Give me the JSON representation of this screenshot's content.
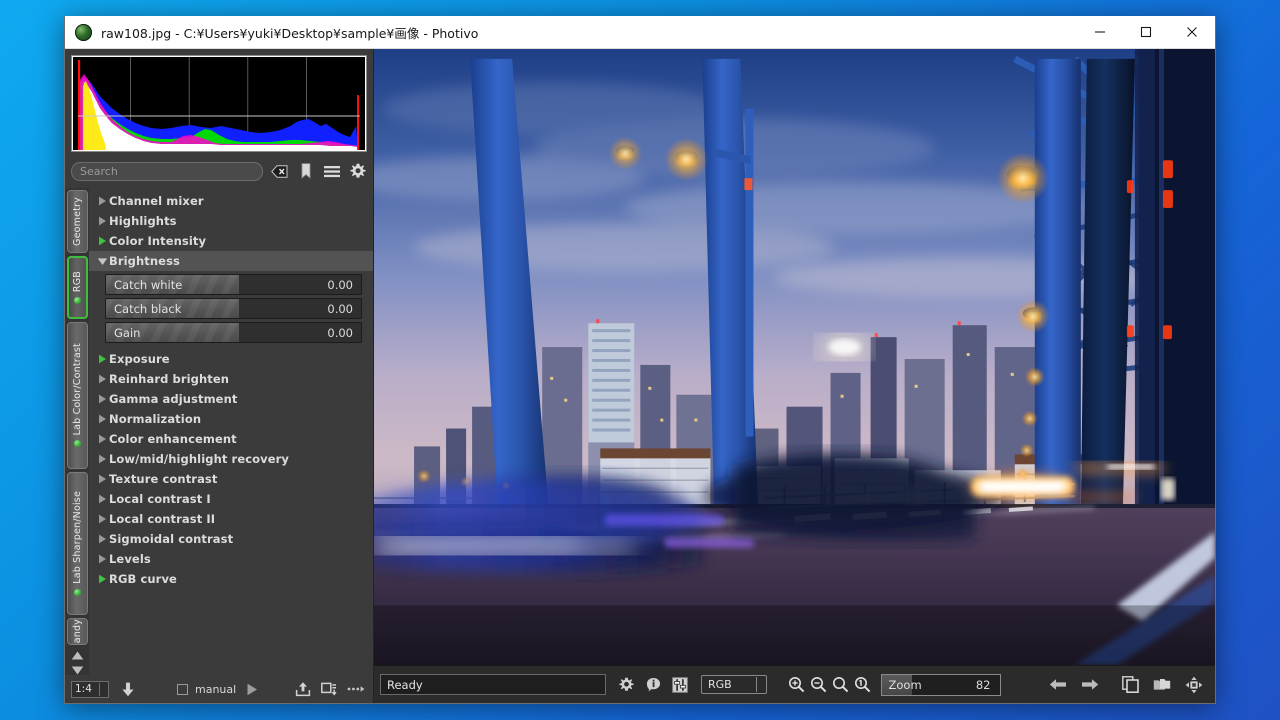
{
  "desktop": {
    "bg_top_left": "#0fa9f0",
    "bg_bottom_right": "#1f51c4"
  },
  "window": {
    "title": "raw108.jpg - C:¥Users¥yuki¥Desktop¥sample¥画像 - Photivo",
    "app_name": "Photivo",
    "file_name": "raw108.jpg",
    "file_path": "C:¥Users¥yuki¥Desktop¥sample¥画像",
    "icon": "photivo-app-icon",
    "controls": {
      "minimize": "minimize-icon",
      "maximize": "maximize-icon",
      "close": "close-icon"
    }
  },
  "histogram": {
    "name": "rgb-histogram",
    "background": "#000000",
    "channels": [
      "red",
      "green",
      "blue"
    ],
    "gridlines": 4
  },
  "search": {
    "placeholder": "Search",
    "value": "",
    "icons": [
      {
        "name": "clear-search-icon",
        "glyph": "backspace-x"
      },
      {
        "name": "bookmark-icon",
        "glyph": "bookmark"
      },
      {
        "name": "menu-icon",
        "glyph": "hamburger"
      },
      {
        "name": "settings-gear-icon",
        "glyph": "gear"
      }
    ]
  },
  "vertical_tabs": {
    "active": "RGB",
    "items": [
      {
        "label": "Geometry",
        "active": false,
        "has_dot": false
      },
      {
        "label": "RGB",
        "active": true,
        "has_dot": true
      },
      {
        "label": "Lab Color/Contrast",
        "active": false,
        "has_dot": true
      },
      {
        "label": "Lab Sharpen/Noise",
        "active": false,
        "has_dot": true
      },
      {
        "label": "andy",
        "active": false,
        "has_dot": false
      }
    ],
    "scroll_up": "scroll-up-arrow",
    "scroll_down": "scroll-down-arrow"
  },
  "tools": [
    {
      "label": "Channel mixer",
      "expanded": false,
      "active": false
    },
    {
      "label": "Highlights",
      "expanded": false,
      "active": false
    },
    {
      "label": "Color Intensity",
      "expanded": false,
      "active": true
    },
    {
      "label": "Brightness",
      "expanded": true,
      "active": false,
      "sliders": [
        {
          "label": "Catch white",
          "value": "0.00",
          "fill_percent": 52
        },
        {
          "label": "Catch black",
          "value": "0.00",
          "fill_percent": 52
        },
        {
          "label": "Gain",
          "value": "0.00",
          "fill_percent": 52
        }
      ]
    },
    {
      "label": "Exposure",
      "expanded": false,
      "active": true
    },
    {
      "label": "Reinhard brighten",
      "expanded": false,
      "active": false
    },
    {
      "label": "Gamma adjustment",
      "expanded": false,
      "active": false
    },
    {
      "label": "Normalization",
      "expanded": false,
      "active": false
    },
    {
      "label": "Color enhancement",
      "expanded": false,
      "active": false
    },
    {
      "label": "Low/mid/highlight recovery",
      "expanded": false,
      "active": false
    },
    {
      "label": "Texture contrast",
      "expanded": false,
      "active": false
    },
    {
      "label": "Local contrast I",
      "expanded": false,
      "active": false
    },
    {
      "label": "Local contrast II",
      "expanded": false,
      "active": false
    },
    {
      "label": "Sigmoidal contrast",
      "expanded": false,
      "active": false
    },
    {
      "label": "Levels",
      "expanded": false,
      "active": false
    },
    {
      "label": "RGB curve",
      "expanded": false,
      "active": true
    }
  ],
  "pipeline_bar": {
    "size_value": "1:4",
    "run_icon": "down-arrow-run-icon",
    "manual_checked": false,
    "manual_label": "manual",
    "play_icon": "play-triangle-icon",
    "export_icon": "export-upload-icon",
    "batch_icon": "batch-download-icon",
    "more_icon": "more-dots-icon"
  },
  "statusbar": {
    "message": "Ready",
    "icons": [
      {
        "name": "settings-gear-icon",
        "glyph": "gear"
      },
      {
        "name": "info-icon",
        "glyph": "info-bubble"
      },
      {
        "name": "channels-icon",
        "glyph": "sliders"
      }
    ],
    "colorspace": "RGB"
  },
  "zoom_controls": {
    "zoom_in_icon": "zoom-in-icon",
    "zoom_out_icon": "zoom-out-icon",
    "zoom_fit_icon": "zoom-fit-icon",
    "zoom_100_icon": "zoom-100-icon",
    "label": "Zoom",
    "value": "82",
    "fill_percent": 26,
    "prev_icon": "previous-arrow-icon",
    "next_icon": "next-arrow-icon"
  },
  "bottom_right_icons": [
    {
      "name": "duplicate-icon",
      "glyph": "copy"
    },
    {
      "name": "folder-icon",
      "glyph": "folder"
    },
    {
      "name": "pan-move-icon",
      "glyph": "move"
    }
  ],
  "photo": {
    "name": "bridge-night-cityscape-photo",
    "description": "Motion-blurred twilight photo taken from a moving vehicle on a blue steel truss bridge, city skyline and car light trails"
  }
}
